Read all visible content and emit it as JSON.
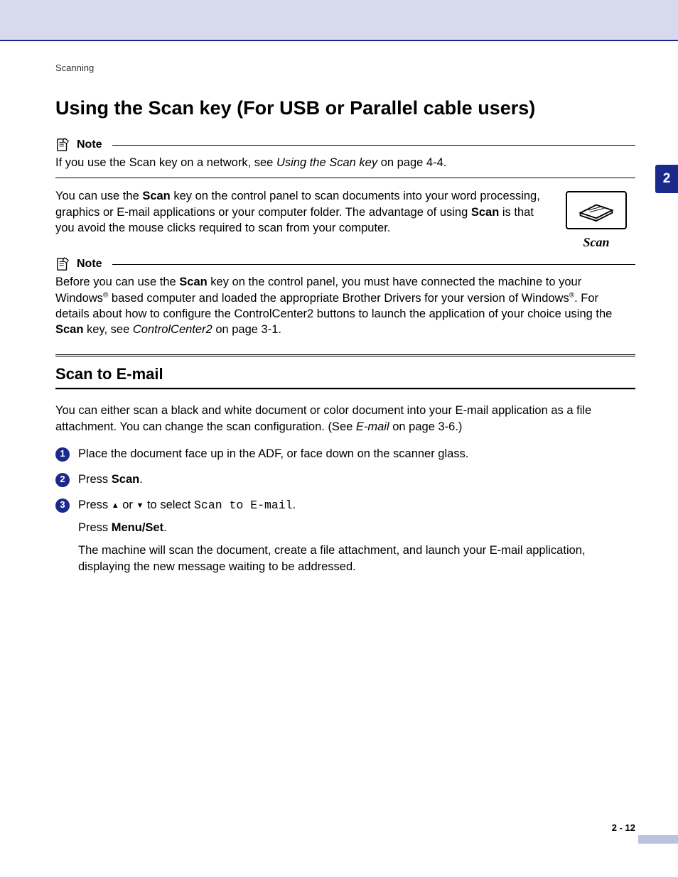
{
  "breadcrumb": "Scanning",
  "title": "Using the Scan key (For USB or Parallel cable users)",
  "side_tab": "2",
  "note1": {
    "label": "Note",
    "text_pre": "If you use the Scan key on a network, see ",
    "link": "Using the Scan key",
    "text_post": " on page 4-4."
  },
  "intro": {
    "seg1": "You can use the ",
    "bold1": "Scan",
    "seg2": " key on the control panel to scan documents into your word processing, graphics or E-mail applications or your computer folder. The advantage of using ",
    "bold2": "Scan",
    "seg3": " is that you avoid the mouse clicks required to scan from your computer."
  },
  "scan_caption": "Scan",
  "note2": {
    "label": "Note",
    "seg1": "Before you can use the ",
    "bold1": "Scan",
    "seg2": " key on the control panel, you must have connected the machine to your Windows",
    "sup1": "®",
    "seg3": " based computer and loaded the appropriate Brother Drivers for your version of Windows",
    "sup2": "®",
    "seg4": ". For details about how to configure the ControlCenter2 buttons to launch the application of your choice using the ",
    "bold2": "Scan",
    "seg5": " key, see ",
    "link": "ControlCenter2",
    "seg6": " on page 3-1."
  },
  "h2": "Scan to E-mail",
  "scan_para": {
    "seg1": "You can either scan a black and white document or color document into your E-mail application as a file attachment. You can change the scan configuration. (See ",
    "link": "E-mail",
    "seg2": " on page 3-6.)"
  },
  "steps": {
    "s1": "Place the document face up in the ADF, or face down on the scanner glass.",
    "s2_pre": "Press ",
    "s2_bold": "Scan",
    "s2_post": ".",
    "s3_pre": "Press ",
    "s3_or": " or ",
    "s3_sel": " to select ",
    "s3_mono": "Scan to E-mail",
    "s3_post": ".",
    "s3b_pre": "Press ",
    "s3b_bold": "Menu/Set",
    "s3b_post": ".",
    "s3c": "The machine will scan the document, create a file attachment, and launch your E-mail application, displaying the new message waiting to be addressed."
  },
  "page_number": "2 - 12"
}
